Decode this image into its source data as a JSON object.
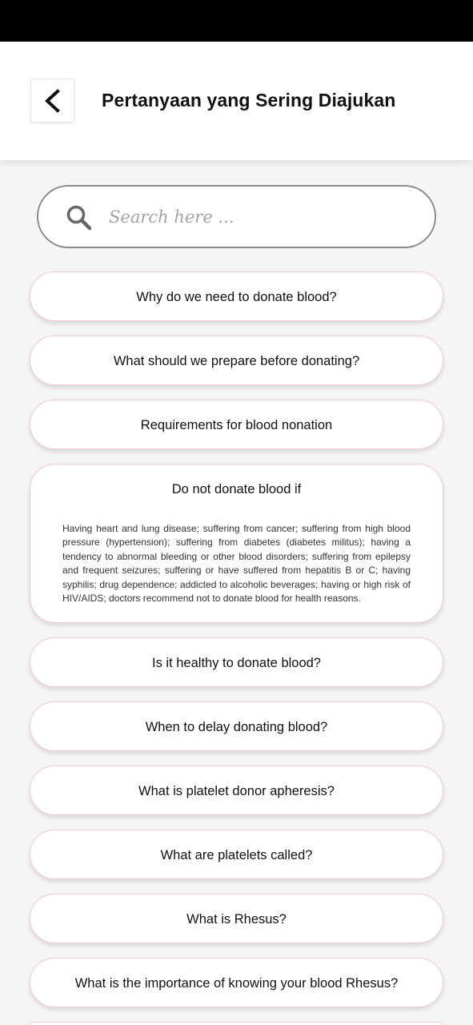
{
  "header": {
    "title": "Pertanyaan yang Sering Diajukan",
    "back_icon": "chevron-left-icon"
  },
  "search": {
    "placeholder": "Search here ...",
    "icon": "search-icon"
  },
  "faq": [
    {
      "question": "Why do we need to donate blood?"
    },
    {
      "question": "What should we prepare before donating?"
    },
    {
      "question": "Requirements for blood nonation"
    },
    {
      "question": "Do not donate blood if",
      "answer": "Having heart and lung disease; suffering from cancer; suffering from high blood pressure (hypertension); suffering from diabetes (diabetes militus); having a tendency to abnormal bleeding or other blood disorders; suffering from epilepsy and frequent seizures; suffering or have suffered from hepatitis B or C; having syphilis; drug dependence; addicted to alcoholic beverages; having or high risk of HIV/AIDS; doctors recommend not to donate blood for health reasons."
    },
    {
      "question": "Is it healthy to donate blood?"
    },
    {
      "question": "When to delay donating blood?"
    },
    {
      "question": "What is platelet donor apheresis?"
    },
    {
      "question": "What are platelets called?"
    },
    {
      "question": "What is Rhesus?"
    },
    {
      "question": "What is the importance of knowing your blood Rhesus?"
    }
  ],
  "colors": {
    "status_bar": "#000000",
    "card_border": "#f2c9d4",
    "background": "#f5f5f5"
  }
}
